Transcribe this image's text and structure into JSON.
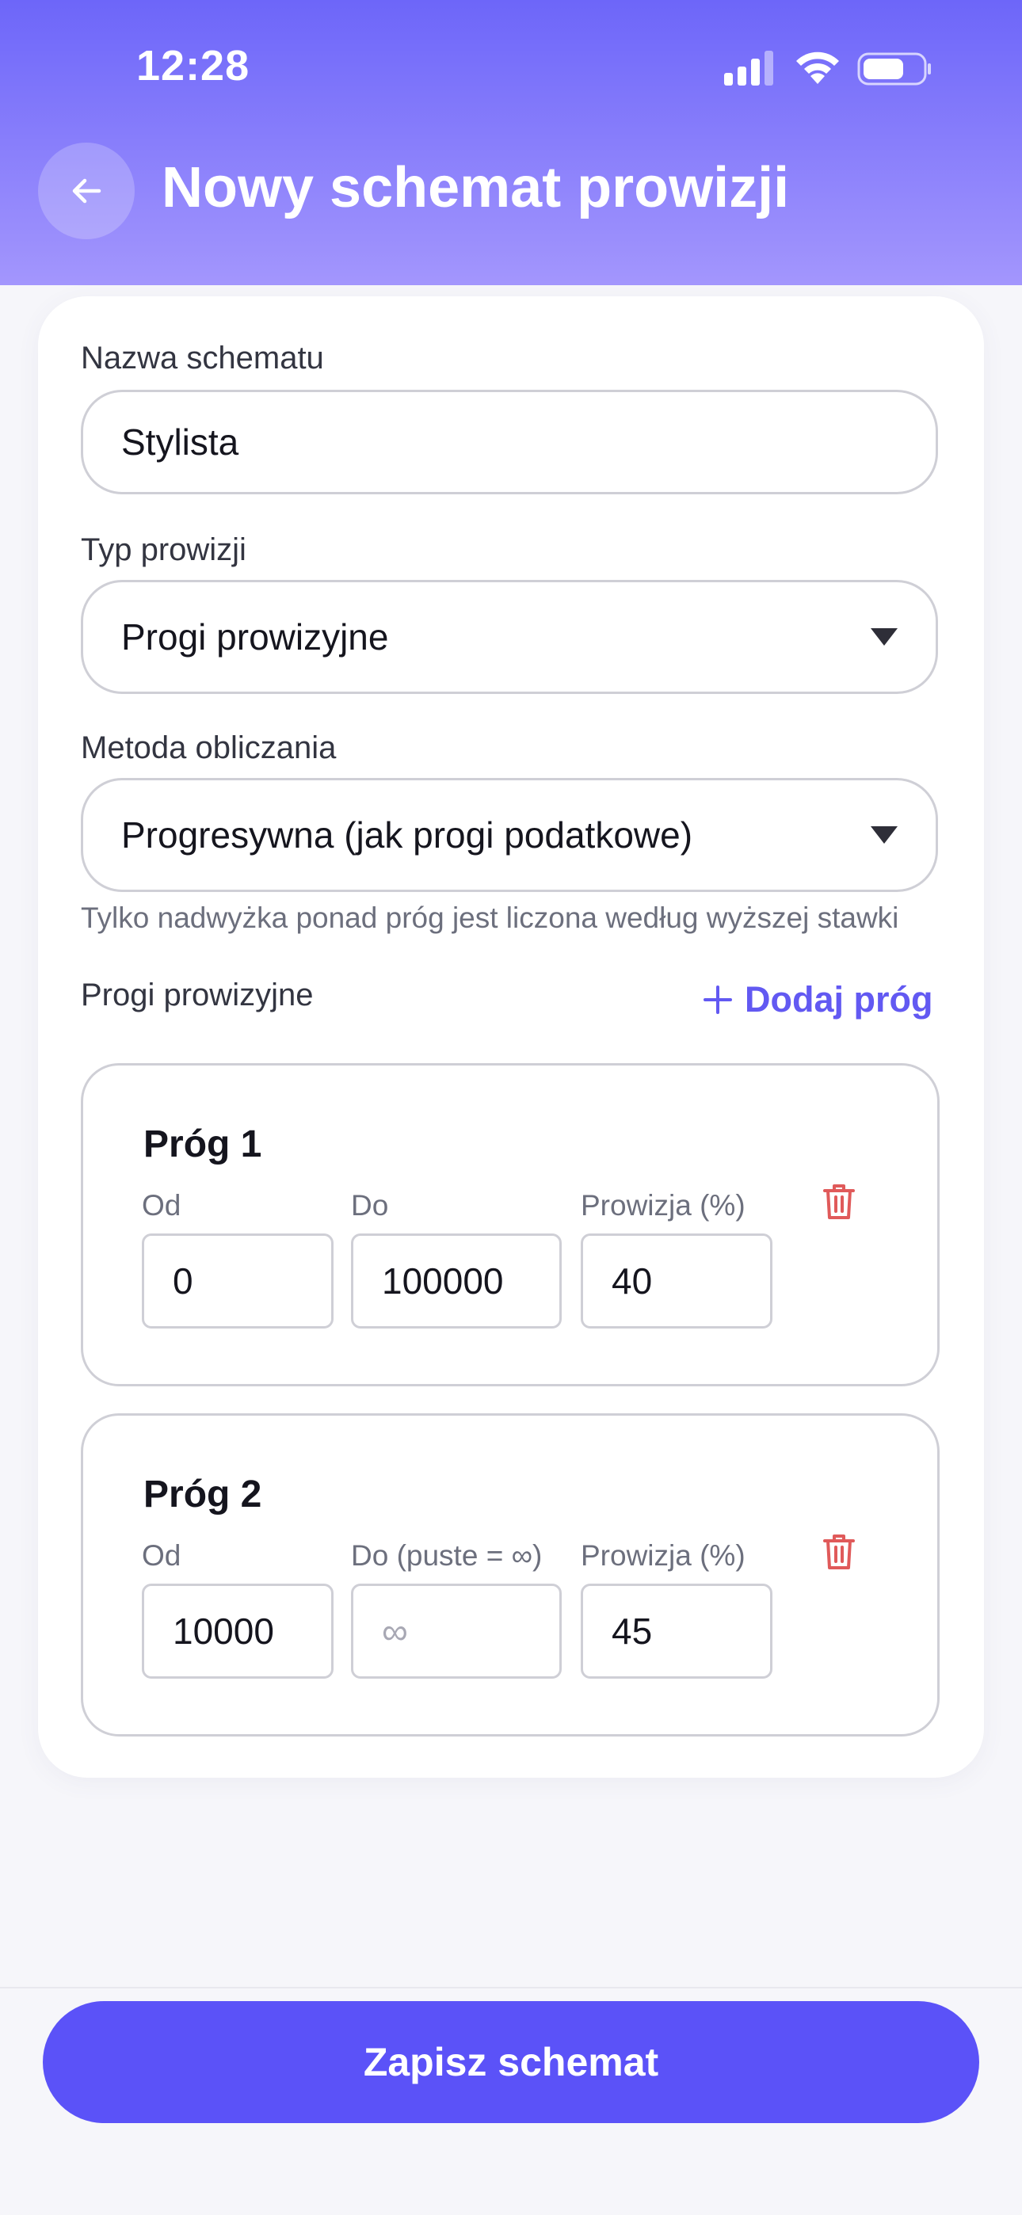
{
  "status_bar": {
    "time": "12:28"
  },
  "header": {
    "title": "Nowy schemat prowizji"
  },
  "form": {
    "name": {
      "label": "Nazwa schematu",
      "value": "Stylista"
    },
    "type": {
      "label": "Typ prowizji",
      "value": "Progi prowizyjne"
    },
    "method": {
      "label": "Metoda obliczania",
      "value": "Progresywna (jak progi podatkowe)",
      "helper": "Tylko nadwyżka ponad próg jest liczona według wyższej stawki"
    },
    "tiers_section": {
      "label": "Progi prowizyjne",
      "add_label": "Dodaj próg"
    },
    "tiers": [
      {
        "title": "Próg 1",
        "from_label": "Od",
        "to_label": "Do",
        "commission_label": "Prowizja (%)",
        "from": "0",
        "to": "100000",
        "to_placeholder": "",
        "commission": "40"
      },
      {
        "title": "Próg 2",
        "from_label": "Od",
        "to_label": "Do (puste = ∞)",
        "commission_label": "Prowizja (%)",
        "from": "10000",
        "to": "",
        "to_placeholder": "∞",
        "commission": "45"
      }
    ]
  },
  "footer": {
    "save_label": "Zapisz schemat"
  },
  "colors": {
    "header_gradient_top": "#6d66f9",
    "header_gradient_bottom": "#a396fd",
    "accent": "#5b52f8",
    "delete": "#e05a5a"
  }
}
